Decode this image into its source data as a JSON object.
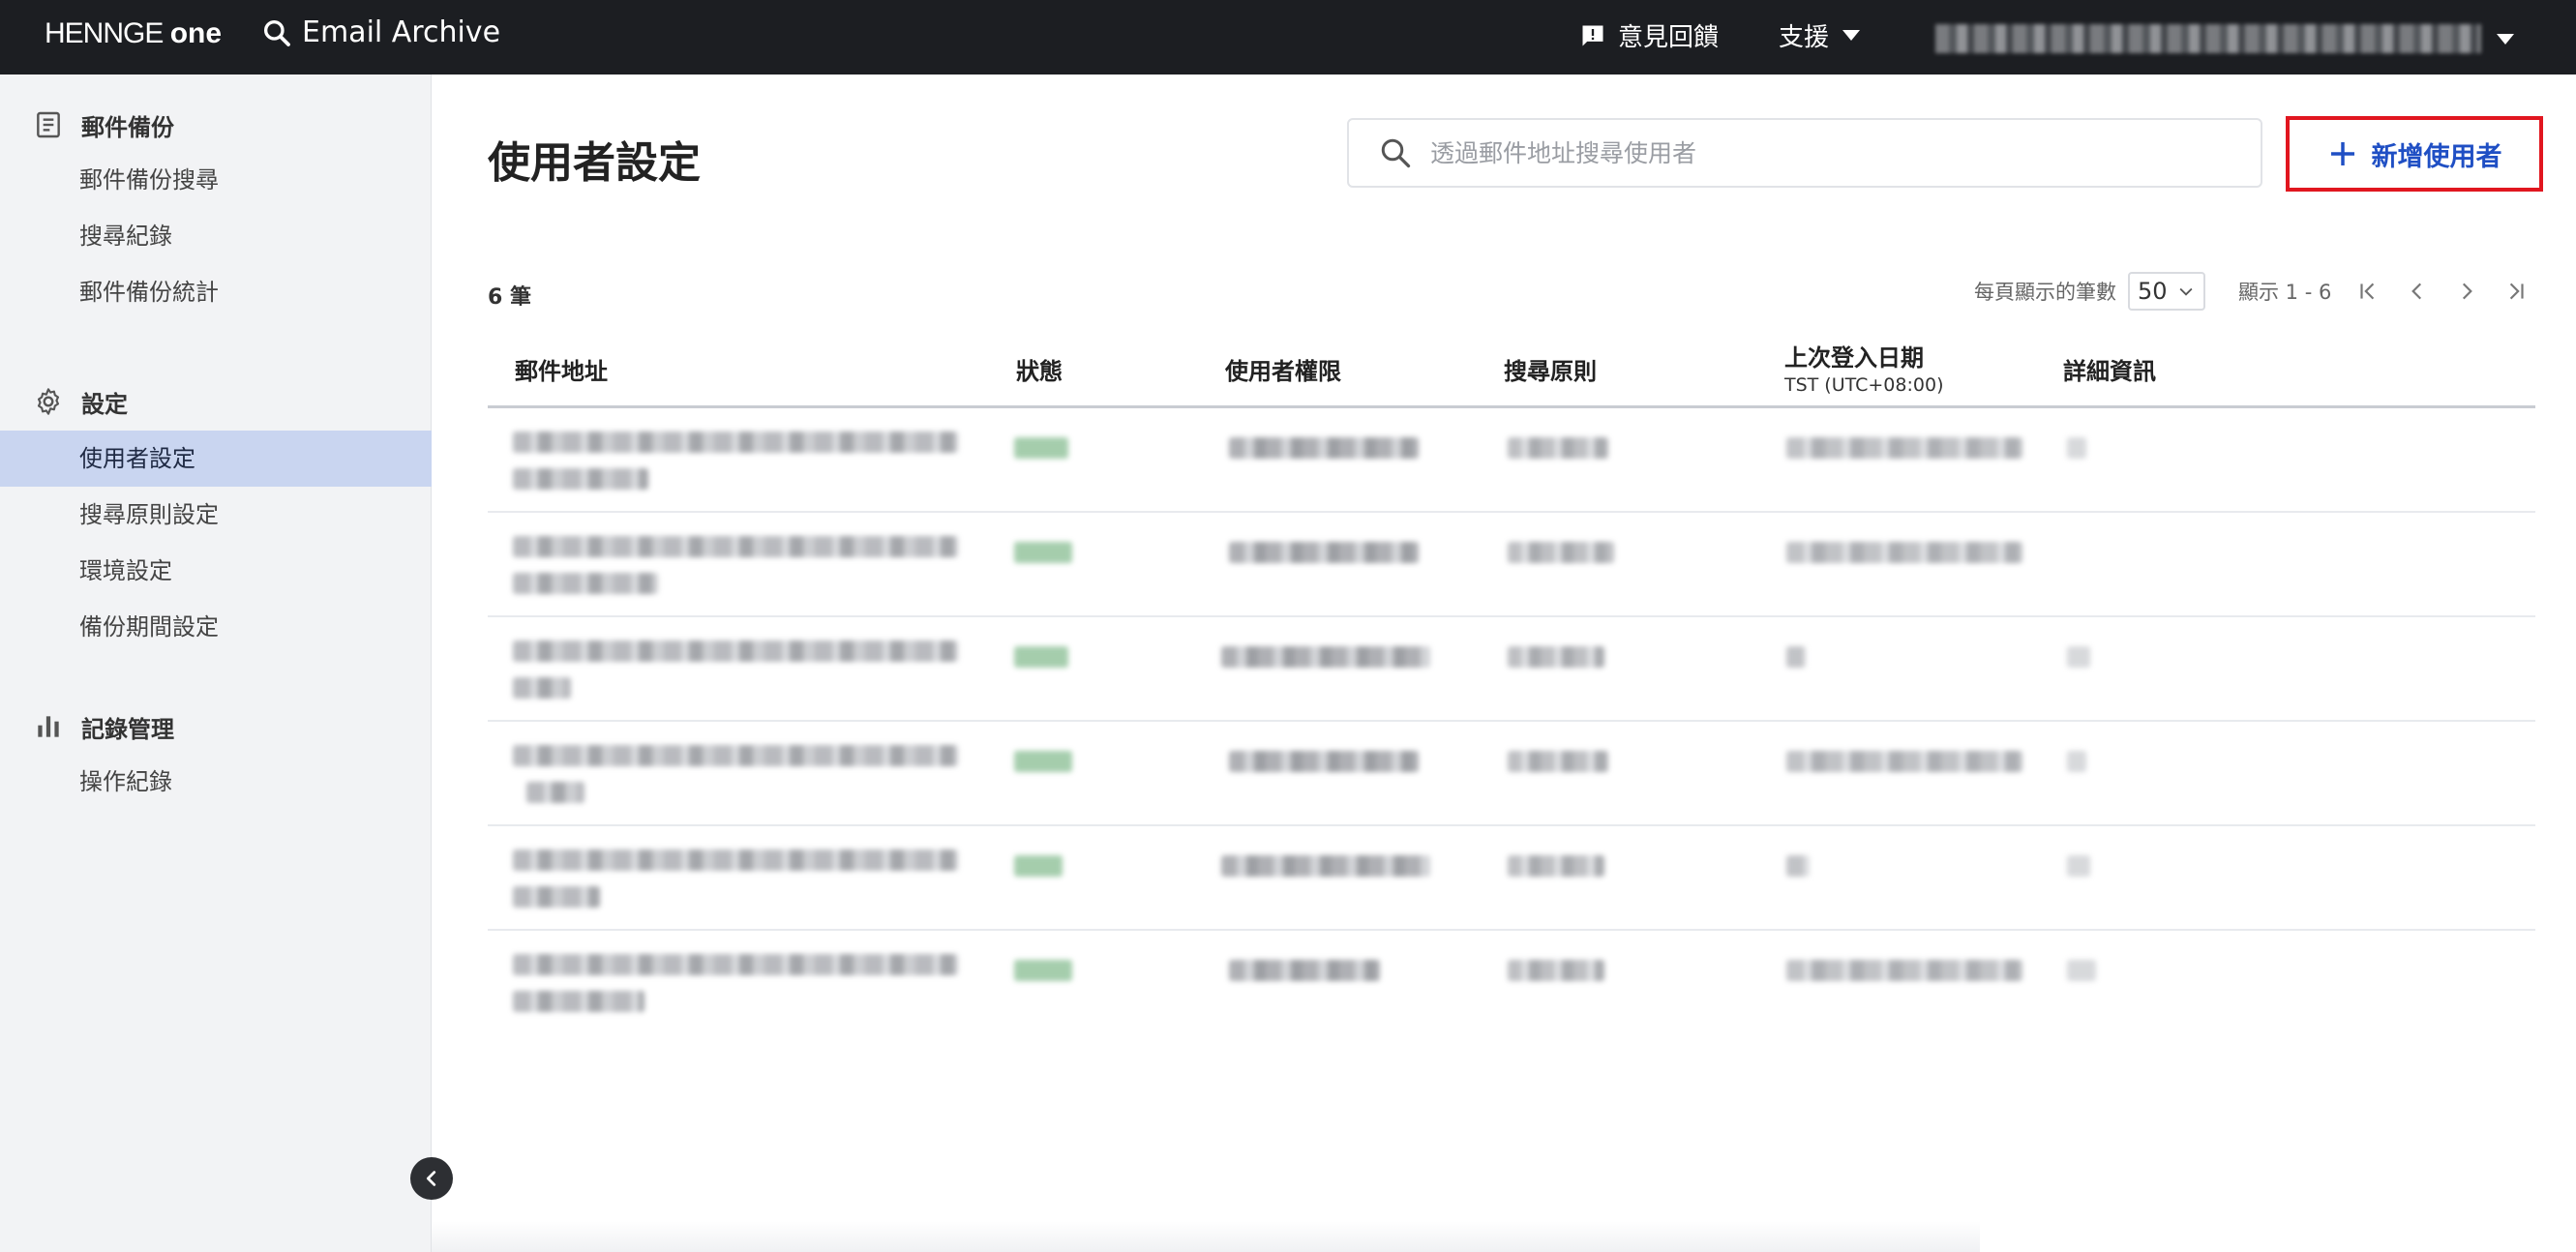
{
  "topbar": {
    "logo_text": "HENNGE",
    "logo_suffix": "one",
    "product_name": "Email Archive",
    "feedback_label": "意見回饋",
    "support_label": "支援"
  },
  "sidebar": {
    "groups": [
      {
        "label": "郵件備份",
        "icon": "document-list-icon",
        "items": [
          "郵件備份搜尋",
          "搜尋紀錄",
          "郵件備份統計"
        ]
      },
      {
        "label": "設定",
        "icon": "gear-icon",
        "items": [
          "使用者設定",
          "搜尋原則設定",
          "環境設定",
          "備份期間設定"
        ]
      },
      {
        "label": "記錄管理",
        "icon": "bar-chart-icon",
        "items": [
          "操作紀錄"
        ]
      }
    ],
    "active_item": "使用者設定"
  },
  "main": {
    "title": "使用者設定",
    "search_placeholder": "透過郵件地址搜尋使用者",
    "add_user_label": "新增使用者",
    "count_label": "6 筆",
    "pager": {
      "per_page_label": "每頁顯示的筆數",
      "per_page_value": "50",
      "range_label": "顯示 1 - 6"
    },
    "table": {
      "columns": [
        "郵件地址",
        "狀態",
        "使用者權限",
        "搜尋原則",
        "上次登入日期",
        "詳細資訊"
      ],
      "last_login_sub": "TST (UTC+08:00)",
      "row_count": 6
    }
  },
  "colors": {
    "topbar_bg": "#1c1e22",
    "sidebar_bg": "#f2f3f5",
    "active_bg": "#c9d5f0",
    "accent_blue": "#1f4fc4",
    "highlight_red": "#e1161f"
  }
}
